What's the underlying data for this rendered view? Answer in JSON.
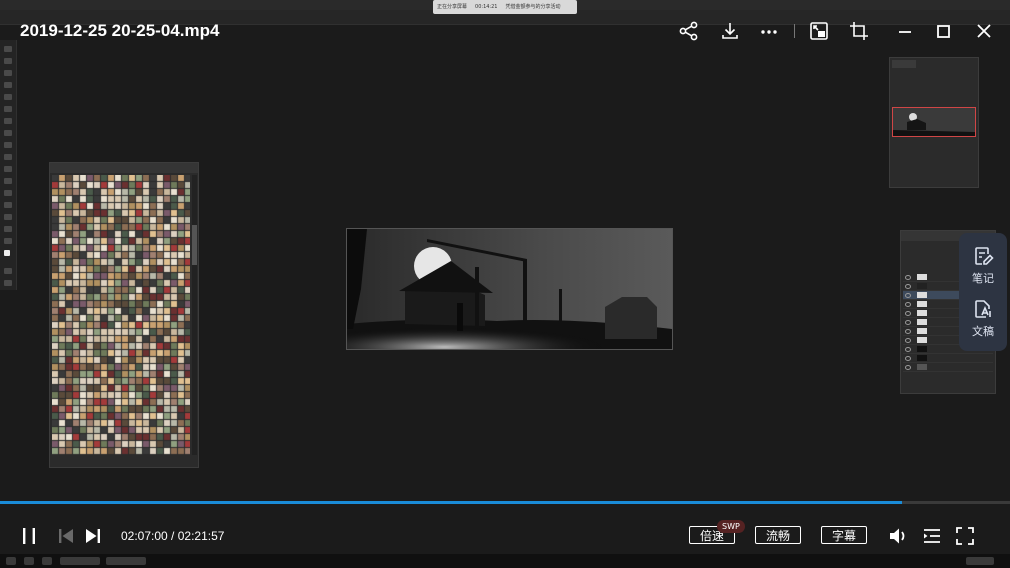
{
  "player": {
    "title": "2019-12-25 20-25-04.mp4",
    "current_time": "02:07:00",
    "total_time": "02:21:57",
    "time_separator": " / ",
    "progress_fraction": 0.8926,
    "accent_color": "#1a8cd8"
  },
  "controls": {
    "speed_label": "倍速",
    "speed_badge": "SWP",
    "quality_label": "流畅",
    "subtitle_label": "字幕"
  },
  "top_icons": [
    "share-icon",
    "download-icon",
    "more-icon",
    "pip-icon",
    "crop-icon",
    "minimize-icon",
    "maximize-icon",
    "close-icon"
  ],
  "side_panel": {
    "notes_label": "笔记",
    "transcript_label": "文稿",
    "background_color": "#2d3442"
  },
  "backdrop": {
    "notice_text_left": "正在分享屏幕",
    "notice_time": "00:14:21",
    "notice_text_right": "凭借金额参与的分享活动"
  }
}
